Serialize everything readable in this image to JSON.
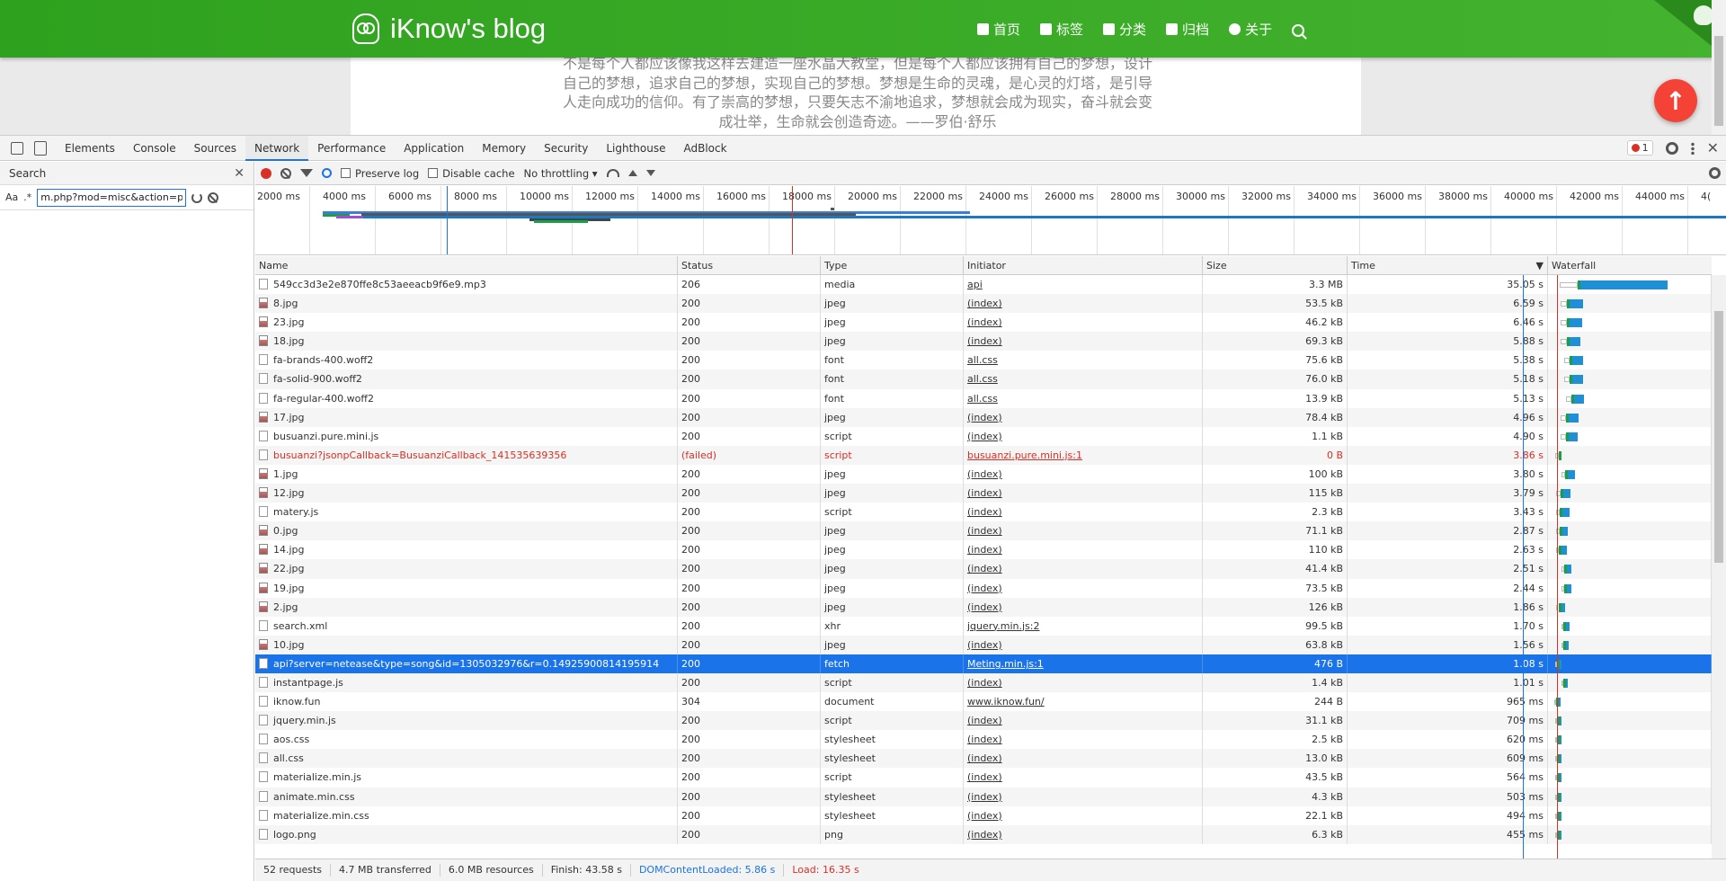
{
  "site": {
    "title": "iKnow's blog",
    "nav": [
      {
        "label": "首页",
        "icon": "home-icon"
      },
      {
        "label": "标签",
        "icon": "tags-icon"
      },
      {
        "label": "分类",
        "icon": "bookmark-icon"
      },
      {
        "label": "归档",
        "icon": "archive-icon"
      },
      {
        "label": "关于",
        "icon": "user-circle-icon"
      }
    ],
    "quote": "不是每个人都应该像我这样去建造一座水晶大教堂，但是每个人都应该拥有自己的梦想，设计自己的梦想，追求自己的梦想，实现自己的梦想。梦想是生命的灵魂，是心灵的灯塔，是引导人走向成功的信仰。有了崇高的梦想，只要矢志不渝地追求，梦想就会成为现实，奋斗就会变成壮举，生命就会创造奇迹。——罗伯·舒乐",
    "back_to_top": "↑",
    "accent": "#3aaa28"
  },
  "devtools": {
    "tabs": [
      "Elements",
      "Console",
      "Sources",
      "Network",
      "Performance",
      "Application",
      "Memory",
      "Security",
      "Lighthouse",
      "AdBlock"
    ],
    "active_tab": "Network",
    "error_count": "1",
    "search": {
      "title": "Search",
      "aa": "Aa",
      "regex": ".*",
      "query": "m.php?mod=misc&action=pay"
    },
    "toolbar": {
      "preserve_log": "Preserve log",
      "disable_cache": "Disable cache",
      "throttling": "No throttling"
    },
    "overview_ticks": [
      "2000 ms",
      "4000 ms",
      "6000 ms",
      "8000 ms",
      "10000 ms",
      "12000 ms",
      "14000 ms",
      "16000 ms",
      "18000 ms",
      "20000 ms",
      "22000 ms",
      "24000 ms",
      "26000 ms",
      "28000 ms",
      "30000 ms",
      "32000 ms",
      "34000 ms",
      "36000 ms",
      "38000 ms",
      "40000 ms",
      "42000 ms",
      "44000 ms",
      "4("
    ],
    "columns": [
      "Name",
      "Status",
      "Type",
      "Initiator",
      "Size",
      "Time",
      "Waterfall"
    ],
    "sort_arrow": "▼",
    "rows": [
      {
        "name": "549cc3d3e2e870ffe8c53aeeacb9f6e9.mp3",
        "status": "206",
        "type": "media",
        "initiator": "api",
        "size": "3.3 MB",
        "time": "35.05 s",
        "img": false
      },
      {
        "name": "8.jpg",
        "status": "200",
        "type": "jpeg",
        "initiator": "(index)",
        "size": "53.5 kB",
        "time": "6.59 s",
        "img": true
      },
      {
        "name": "23.jpg",
        "status": "200",
        "type": "jpeg",
        "initiator": "(index)",
        "size": "46.2 kB",
        "time": "6.46 s",
        "img": true
      },
      {
        "name": "18.jpg",
        "status": "200",
        "type": "jpeg",
        "initiator": "(index)",
        "size": "69.3 kB",
        "time": "5.88 s",
        "img": true
      },
      {
        "name": "fa-brands-400.woff2",
        "status": "200",
        "type": "font",
        "initiator": "all.css",
        "size": "75.6 kB",
        "time": "5.38 s",
        "img": false
      },
      {
        "name": "fa-solid-900.woff2",
        "status": "200",
        "type": "font",
        "initiator": "all.css",
        "size": "76.0 kB",
        "time": "5.18 s",
        "img": false
      },
      {
        "name": "fa-regular-400.woff2",
        "status": "200",
        "type": "font",
        "initiator": "all.css",
        "size": "13.9 kB",
        "time": "5.13 s",
        "img": false
      },
      {
        "name": "17.jpg",
        "status": "200",
        "type": "jpeg",
        "initiator": "(index)",
        "size": "78.4 kB",
        "time": "4.96 s",
        "img": true
      },
      {
        "name": "busuanzi.pure.mini.js",
        "status": "200",
        "type": "script",
        "initiator": "(index)",
        "size": "1.1 kB",
        "time": "4.90 s",
        "img": false
      },
      {
        "name": "busuanzi?jsonpCallback=BusuanziCallback_141535639356",
        "status": "(failed)",
        "type": "script",
        "initiator": "busuanzi.pure.mini.js:1",
        "size": "0 B",
        "time": "3.86 s",
        "img": false,
        "error": true
      },
      {
        "name": "1.jpg",
        "status": "200",
        "type": "jpeg",
        "initiator": "(index)",
        "size": "100 kB",
        "time": "3.80 s",
        "img": true
      },
      {
        "name": "12.jpg",
        "status": "200",
        "type": "jpeg",
        "initiator": "(index)",
        "size": "115 kB",
        "time": "3.79 s",
        "img": true
      },
      {
        "name": "matery.js",
        "status": "200",
        "type": "script",
        "initiator": "(index)",
        "size": "2.3 kB",
        "time": "3.43 s",
        "img": false
      },
      {
        "name": "0.jpg",
        "status": "200",
        "type": "jpeg",
        "initiator": "(index)",
        "size": "71.1 kB",
        "time": "2.87 s",
        "img": true
      },
      {
        "name": "14.jpg",
        "status": "200",
        "type": "jpeg",
        "initiator": "(index)",
        "size": "110 kB",
        "time": "2.63 s",
        "img": true
      },
      {
        "name": "22.jpg",
        "status": "200",
        "type": "jpeg",
        "initiator": "(index)",
        "size": "41.4 kB",
        "time": "2.51 s",
        "img": true
      },
      {
        "name": "19.jpg",
        "status": "200",
        "type": "jpeg",
        "initiator": "(index)",
        "size": "73.5 kB",
        "time": "2.44 s",
        "img": true
      },
      {
        "name": "2.jpg",
        "status": "200",
        "type": "jpeg",
        "initiator": "(index)",
        "size": "126 kB",
        "time": "1.86 s",
        "img": true
      },
      {
        "name": "search.xml",
        "status": "200",
        "type": "xhr",
        "initiator": "jquery.min.js:2",
        "size": "99.5 kB",
        "time": "1.70 s",
        "img": false
      },
      {
        "name": "10.jpg",
        "status": "200",
        "type": "jpeg",
        "initiator": "(index)",
        "size": "63.8 kB",
        "time": "1.56 s",
        "img": true
      },
      {
        "name": "api?server=netease&type=song&id=1305032976&r=0.14925900814195914",
        "status": "200",
        "type": "fetch",
        "initiator": "Meting.min.js:1",
        "size": "476 B",
        "time": "1.08 s",
        "img": false,
        "selected": true
      },
      {
        "name": "instantpage.js",
        "status": "200",
        "type": "script",
        "initiator": "(index)",
        "size": "1.4 kB",
        "time": "1.01 s",
        "img": false
      },
      {
        "name": "iknow.fun",
        "status": "304",
        "type": "document",
        "initiator": "www.iknow.fun/",
        "size": "244 B",
        "time": "965 ms",
        "img": false
      },
      {
        "name": "jquery.min.js",
        "status": "200",
        "type": "script",
        "initiator": "(index)",
        "size": "31.1 kB",
        "time": "709 ms",
        "img": false
      },
      {
        "name": "aos.css",
        "status": "200",
        "type": "stylesheet",
        "initiator": "(index)",
        "size": "2.5 kB",
        "time": "620 ms",
        "img": false
      },
      {
        "name": "all.css",
        "status": "200",
        "type": "stylesheet",
        "initiator": "(index)",
        "size": "13.0 kB",
        "time": "609 ms",
        "img": false
      },
      {
        "name": "materialize.min.js",
        "status": "200",
        "type": "script",
        "initiator": "(index)",
        "size": "43.5 kB",
        "time": "564 ms",
        "img": false
      },
      {
        "name": "animate.min.css",
        "status": "200",
        "type": "stylesheet",
        "initiator": "(index)",
        "size": "4.3 kB",
        "time": "503 ms",
        "img": false
      },
      {
        "name": "materialize.min.css",
        "status": "200",
        "type": "stylesheet",
        "initiator": "(index)",
        "size": "22.1 kB",
        "time": "494 ms",
        "img": false
      },
      {
        "name": "logo.png",
        "status": "200",
        "type": "png",
        "initiator": "(index)",
        "size": "6.3 kB",
        "time": "455 ms",
        "img": false
      }
    ],
    "status_bar": {
      "requests": "52 requests",
      "transferred": "4.7 MB transferred",
      "resources": "6.0 MB resources",
      "finish": "Finish: 43.58 s",
      "dcl": "DOMContentLoaded: 5.86 s",
      "load": "Load: 16.35 s"
    },
    "colors": {
      "selected": "#1a73e8",
      "error": "#d93025",
      "dcl_line": "#1a73e8",
      "load_line": "#d93025"
    }
  }
}
